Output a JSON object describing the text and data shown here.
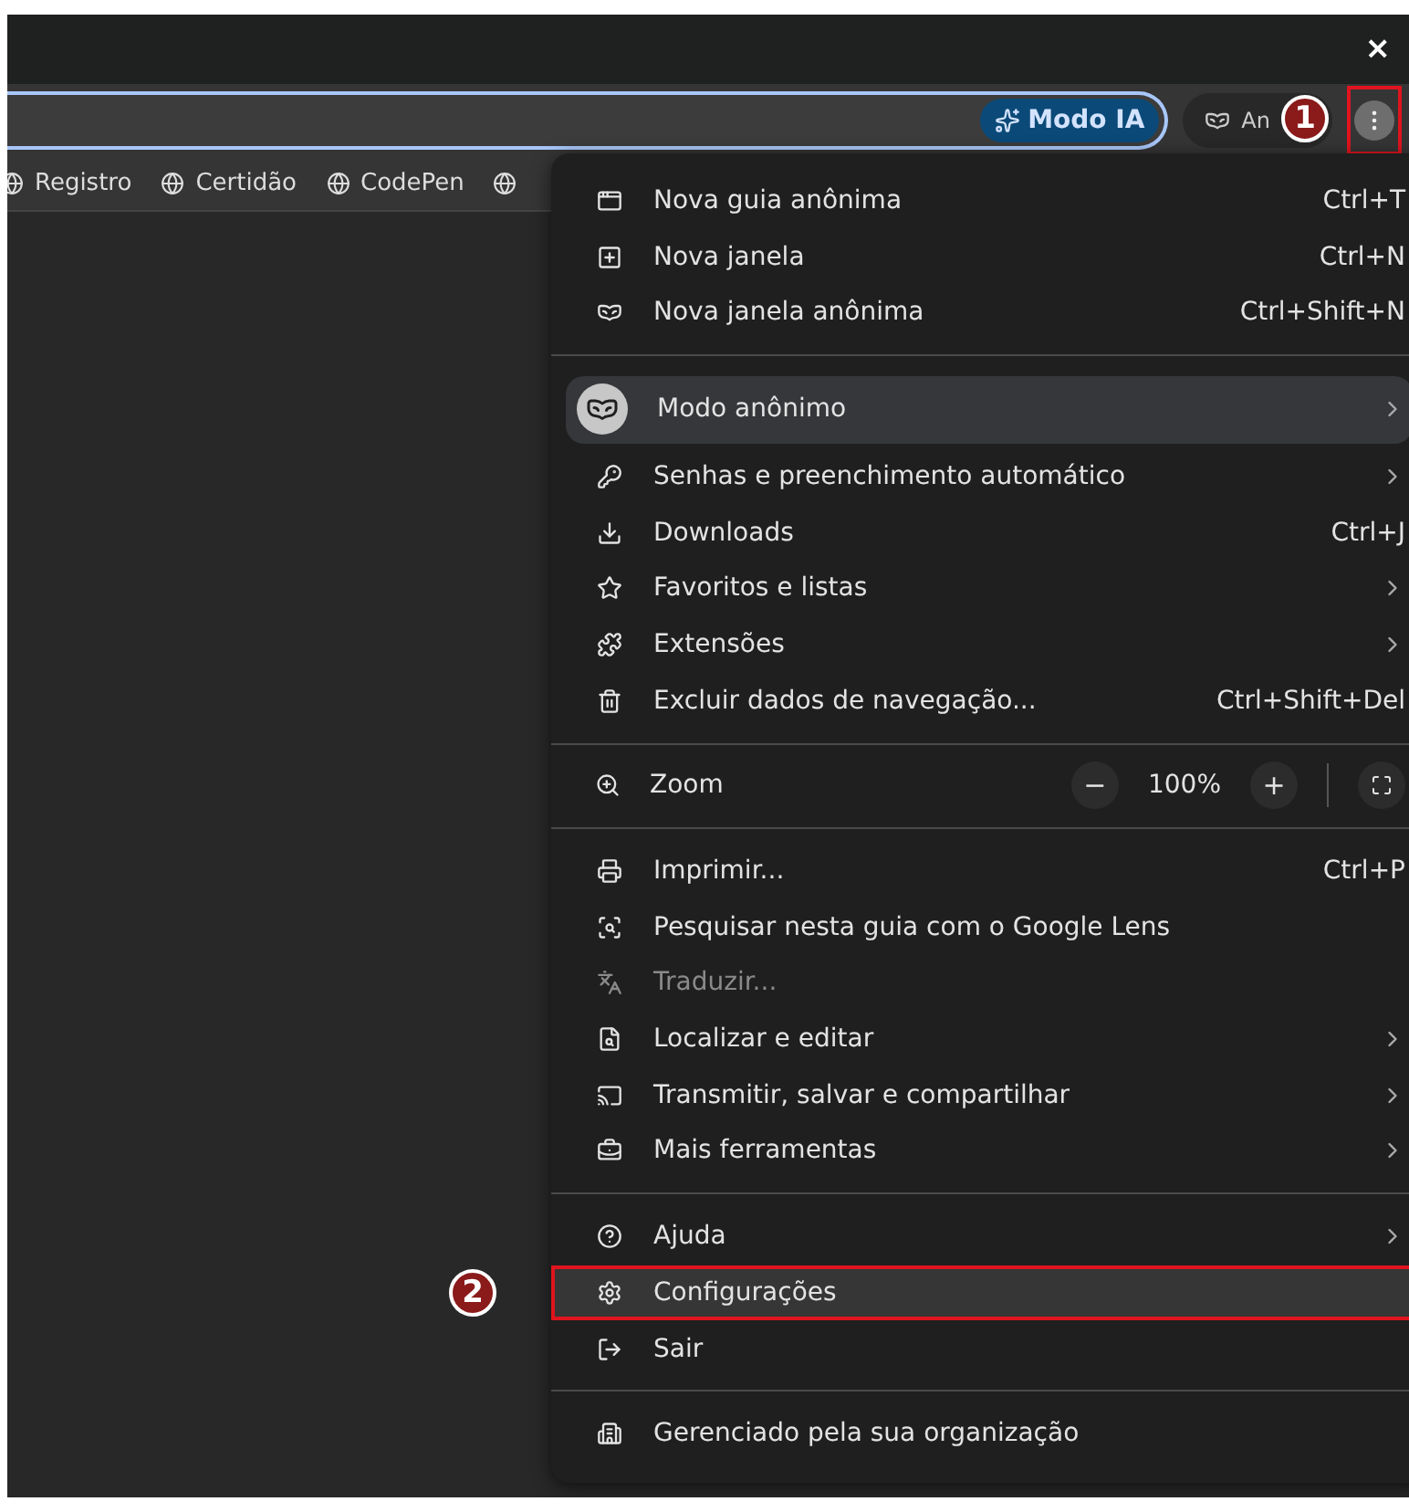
{
  "title_bar": {
    "close": "×"
  },
  "toolbar": {
    "ai_mode_button": "Modo IA",
    "profile_chip": "An",
    "menu_button_outlined": true,
    "badge": "1"
  },
  "bookmarks": [
    "Registro",
    "Certidão",
    "CodePen"
  ],
  "menu": {
    "sections": [
      [
        {
          "kind": "item",
          "label": "Nova guia anônima",
          "shortcut": "Ctrl+T",
          "submenu": false,
          "highlighted": false,
          "disabled": false,
          "outlined": false
        },
        {
          "kind": "item",
          "label": "Nova janela",
          "shortcut": "Ctrl+N",
          "submenu": false,
          "highlighted": false,
          "disabled": false,
          "outlined": false
        },
        {
          "kind": "item",
          "label": "Nova janela anônima",
          "shortcut": "Ctrl+Shift+N",
          "submenu": false,
          "highlighted": false,
          "disabled": false,
          "outlined": false
        }
      ],
      [
        {
          "kind": "item",
          "label": "Modo anônimo",
          "submenu": true,
          "highlighted": true,
          "disabled": false,
          "outlined": false
        },
        {
          "kind": "item",
          "label": "Senhas e preenchimento automático",
          "submenu": true,
          "highlighted": false,
          "disabled": false,
          "outlined": false
        },
        {
          "kind": "item",
          "label": "Downloads",
          "shortcut": "Ctrl+J",
          "submenu": false,
          "highlighted": false,
          "disabled": false,
          "outlined": false
        },
        {
          "kind": "item",
          "label": "Favoritos e listas",
          "submenu": true,
          "highlighted": false,
          "disabled": false,
          "outlined": false
        },
        {
          "kind": "item",
          "label": "Extensões",
          "submenu": true,
          "highlighted": false,
          "disabled": false,
          "outlined": false
        },
        {
          "kind": "item",
          "label": "Excluir dados de navegação...",
          "shortcut": "Ctrl+Shift+Del",
          "submenu": false,
          "highlighted": false,
          "disabled": false,
          "outlined": false
        }
      ],
      [
        {
          "kind": "zoom",
          "label": "Zoom",
          "minus": "−",
          "value": "100%",
          "plus": "+"
        }
      ],
      [
        {
          "kind": "item",
          "label": "Imprimir...",
          "shortcut": "Ctrl+P",
          "submenu": false,
          "highlighted": false,
          "disabled": false,
          "outlined": false
        },
        {
          "kind": "item",
          "label": "Pesquisar nesta guia com o Google Lens",
          "submenu": false,
          "highlighted": false,
          "disabled": false,
          "outlined": false
        },
        {
          "kind": "item",
          "label": "Traduzir...",
          "submenu": false,
          "highlighted": false,
          "disabled": true,
          "outlined": false
        },
        {
          "kind": "item",
          "label": "Localizar e editar",
          "submenu": true,
          "highlighted": false,
          "disabled": false,
          "outlined": false
        },
        {
          "kind": "item",
          "label": "Transmitir, salvar e compartilhar",
          "submenu": true,
          "highlighted": false,
          "disabled": false,
          "outlined": false
        },
        {
          "kind": "item",
          "label": "Mais ferramentas",
          "submenu": true,
          "highlighted": false,
          "disabled": false,
          "outlined": false
        }
      ],
      [
        {
          "kind": "item",
          "label": "Ajuda",
          "submenu": true,
          "highlighted": false,
          "disabled": false,
          "outlined": false
        },
        {
          "kind": "item",
          "label": "Configurações",
          "submenu": false,
          "highlighted": false,
          "disabled": false,
          "outlined": true,
          "badge": "2"
        },
        {
          "kind": "item",
          "label": "Sair",
          "submenu": false,
          "highlighted": false,
          "disabled": false,
          "outlined": false
        }
      ],
      [
        {
          "kind": "item",
          "label": "Gerenciado pela sua organização",
          "submenu": false,
          "highlighted": false,
          "disabled": false,
          "outlined": false
        }
      ]
    ]
  }
}
